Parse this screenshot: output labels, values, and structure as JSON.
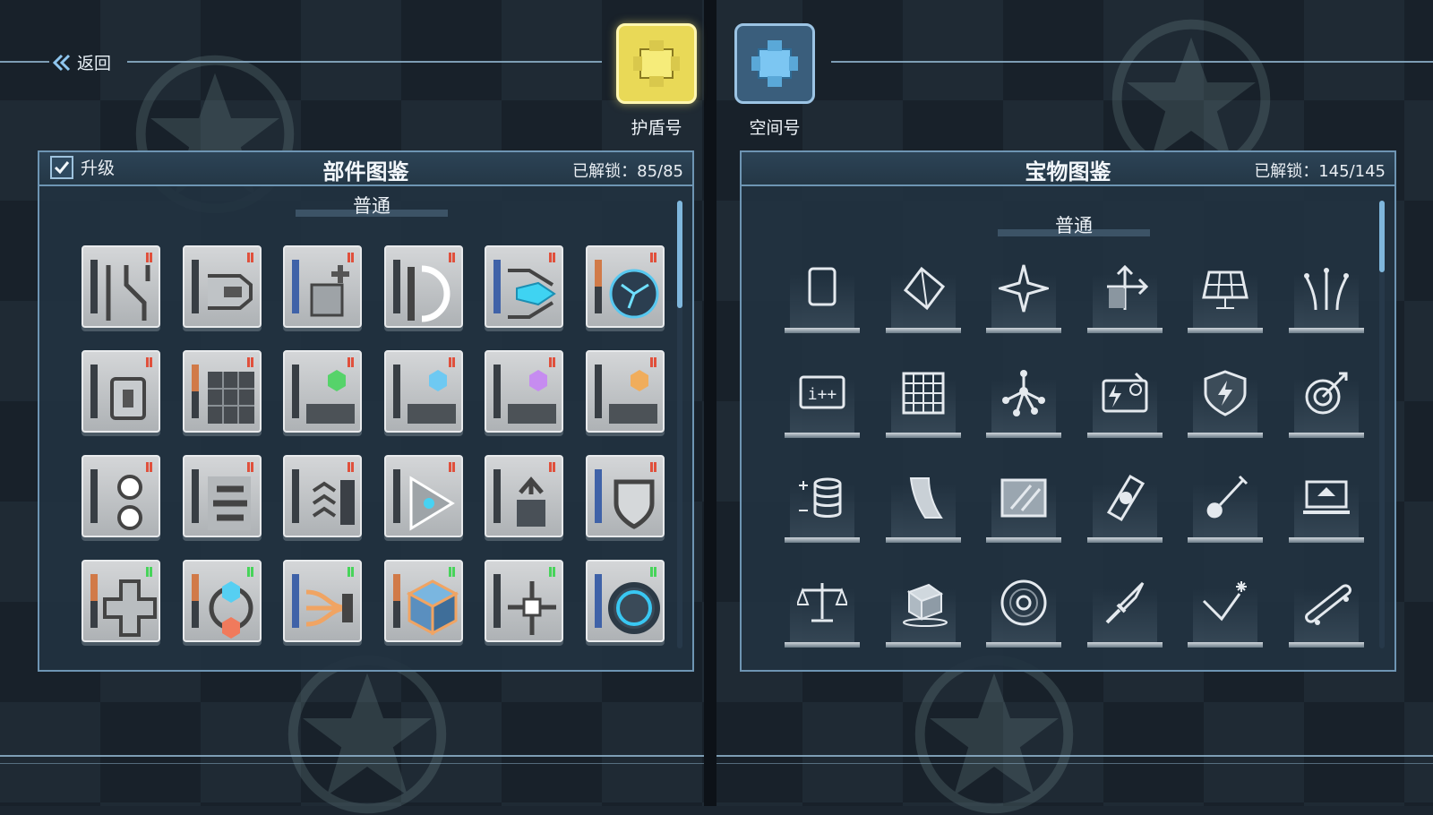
{
  "nav": {
    "back_label": "返回"
  },
  "ships": [
    {
      "name": "护盾号",
      "selected": true,
      "color": "#e9d957"
    },
    {
      "name": "空间号",
      "selected": false,
      "color": "#6fb6e8"
    }
  ],
  "parts_panel": {
    "upgrade_label": "升级",
    "upgrade_checked": true,
    "title": "部件图鉴",
    "unlock_text": "已解锁：85/85",
    "section": "普通",
    "items": [
      "split-track-part",
      "claw-part",
      "plus-block-part",
      "half-ring-part",
      "blue-crystal-part",
      "orb-part",
      "cylinder-part",
      "grid-block-part",
      "green-gem-part",
      "blue-gem-part",
      "purple-gem-part",
      "orange-gem-part",
      "gear-part",
      "stairs-part",
      "chevron-part",
      "triangle-part",
      "arrow-up-part",
      "shield-part",
      "cross-part",
      "hex-ring-part",
      "cable-part",
      "cube-part",
      "node-part",
      "portal-part"
    ]
  },
  "treasure_panel": {
    "title": "宝物图鉴",
    "unlock_text": "已解锁：145/145",
    "section": "普通",
    "items": [
      "card-icon",
      "prism-icon",
      "star-icon",
      "axis-arrow-icon",
      "solar-panel-icon",
      "fireworks-icon",
      "increment-icon",
      "grid-icon",
      "molecule-icon",
      "generator-icon",
      "lightning-shield-icon",
      "target-icon",
      "coin-stack-icon",
      "magazine-icon",
      "glass-panel-icon",
      "candy-bar-icon",
      "guitar-icon",
      "laptop-icon",
      "scale-icon",
      "ice-cube-icon",
      "disc-icon",
      "dagger-icon",
      "check-spark-icon",
      "skateboard-icon"
    ]
  }
}
